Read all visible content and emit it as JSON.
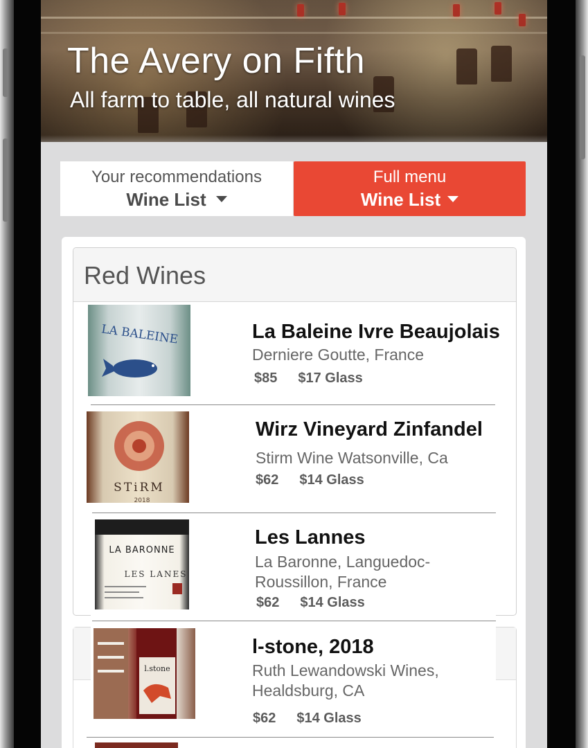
{
  "header": {
    "title": "The Avery on Fifth",
    "subtitle": "All farm to table, all natural wines"
  },
  "tabs": [
    {
      "line1": "Your recommendations",
      "line2": "Wine List",
      "active": false
    },
    {
      "line1": "Full menu",
      "line2": "Wine List",
      "active": true
    }
  ],
  "colors": {
    "accent": "#e94834"
  },
  "section": {
    "title": "Red Wines"
  },
  "wines": [
    {
      "name": "La Baleine Ivre Beaujolais",
      "producer": "Derniere Goutte, France",
      "bottle_price": "$85",
      "glass_price": "$17 Glass",
      "label_text": "LA BALEINE",
      "icon": "whale-bottle-image"
    },
    {
      "name": "Wirz Vineyard Zinfandel",
      "producer": "Stirm Wine Watsonville, Ca",
      "bottle_price": "$62",
      "glass_price": "$14 Glass",
      "label_text": "STiRM",
      "label_year": "2018",
      "icon": "sun-bottle-image"
    },
    {
      "name": "Les Lannes",
      "producer": "La Baronne, Languedoc-Roussillon, France",
      "bottle_price": "$62",
      "glass_price": "$14 Glass",
      "label_text": "LA BARONNE",
      "label_sub": "LES LANES",
      "icon": "baronne-bottle-image"
    },
    {
      "name": "l-stone, 2018",
      "producer": "Ruth Lewandowski Wines, Healdsburg, CA",
      "bottle_price": "$62",
      "glass_price": "$14 Glass",
      "label_text": "l.stone",
      "icon": "bear-bottle-image"
    }
  ]
}
